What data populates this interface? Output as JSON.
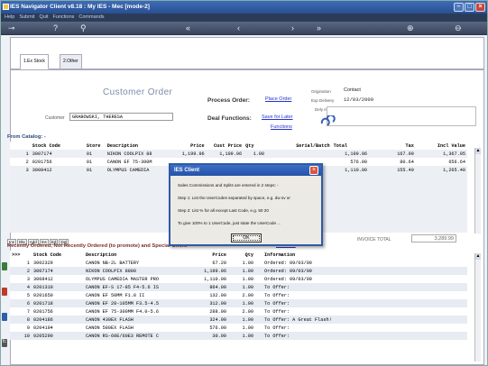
{
  "window": {
    "title": "IES Navigator Client v8.18 : My IES - Mec   [mode-2]"
  },
  "menu": [
    "Help",
    "Submit",
    "Quit",
    "Functions",
    "Commands"
  ],
  "tabs": [
    {
      "label": "1.Ex Stock"
    },
    {
      "label": "2.Other"
    }
  ],
  "order": {
    "title": "Customer Order",
    "process_label": "Process Order:",
    "place_order": "Place Order",
    "origination_label": "Origination",
    "origination_value": "Contact",
    "exp_delivery_label": "Exp Delivery",
    "exp_delivery_value": "12/03/2009",
    "dely_instr_label": "Dely Instr",
    "customer_label": "Customer",
    "customer_value": "GRABOWSKI, THERESA",
    "deal_label": "Deal Functions:",
    "save_later": "Save for Later",
    "functions": "Functions"
  },
  "catalog": {
    "title": "From Catalog: -",
    "headers": [
      "",
      "Stock Code",
      "Store",
      "Description",
      "Price",
      "Cust Price",
      "Qty",
      "Serial/Batch",
      "Total",
      "Tax",
      "Incl Value"
    ],
    "rows": [
      {
        "n": "1",
        "code": "3007174",
        "store": "01",
        "desc": "NIKON COOLPIX 88",
        "price": "1,199.96",
        "cust": "1,199.96",
        "qty": "1.00",
        "serial": "",
        "total": "1,199.96",
        "tax": "167.99",
        "incl": "1,367.95"
      },
      {
        "n": "2",
        "code": "0201756",
        "store": "01",
        "desc": "CANON EF 75-300M",
        "price": "",
        "cust": "",
        "qty": "",
        "serial": "",
        "total": "576.00",
        "tax": "80.64",
        "incl": "656.64"
      },
      {
        "n": "3",
        "code": "3008412",
        "store": "01",
        "desc": "OLYMPUS CAMEDIA",
        "price": "",
        "cust": "",
        "qty": "",
        "serial": "",
        "total": "1,110.00",
        "tax": "155.40",
        "incl": "1,265.40"
      }
    ],
    "edit_buttons": [
      "Ins",
      "Dle",
      "Add",
      "Ins",
      "Ed",
      "Del"
    ]
  },
  "invoice": {
    "label": "INVOICE TOTAL",
    "value": "3,289.99"
  },
  "recent": {
    "title": "Recently Ordered, Not Recently Ordered (to promote) and Special Offers",
    "reorder": "RE-ORD",
    "headers": [
      ">>>",
      "Stock Code",
      "Description",
      "Price",
      "Qty",
      "Information"
    ],
    "rows": [
      {
        "n": "1",
        "code": "3002329",
        "desc": "CANON NB-2L BATTERY",
        "price": "67.20",
        "qty": "1.00",
        "info": "Ordered: 09/03/09"
      },
      {
        "n": "2",
        "code": "3007174",
        "desc": "NIKON COOLPIX 8800",
        "price": "1,199.96",
        "qty": "1.00",
        "info": "Ordered: 09/03/09"
      },
      {
        "n": "3",
        "code": "3008412",
        "desc": "OLYMPUS CAMEDIA MASTER PRO",
        "price": "1,110.00",
        "qty": "1.00",
        "info": "Ordered: 09/03/09"
      },
      {
        "n": "4",
        "code": "0201310",
        "desc": "CANON EF-S 17-85 F4-5.6 IS",
        "price": "864.00",
        "qty": "1.00",
        "info": "To Offer:"
      },
      {
        "n": "5",
        "code": "0201650",
        "desc": "CANON EF 50MM F1.8 II",
        "price": "132.00",
        "qty": "2.00",
        "info": "To Offer:"
      },
      {
        "n": "6",
        "code": "0201718",
        "desc": "CANON EF 28-105MM F3.5-4.5",
        "price": "312.00",
        "qty": "1.00",
        "info": "To Offer:"
      },
      {
        "n": "7",
        "code": "0201756",
        "desc": "CANON EF 75-300MM F4.0-5.6",
        "price": "288.00",
        "qty": "2.00",
        "info": "To Offer:"
      },
      {
        "n": "8",
        "code": "0204186",
        "desc": "CANON 430EX FLASH",
        "price": "324.00",
        "qty": "1.00",
        "info": "To Offer: A Great Flash!"
      },
      {
        "n": "9",
        "code": "0204194",
        "desc": "CANON 580EX FLASH",
        "price": "576.00",
        "qty": "1.00",
        "info": "To Offer:"
      },
      {
        "n": "10",
        "code": "0205290",
        "desc": "CANON RS-60E/60E3 REMOTE C",
        "price": "30.00",
        "qty": "1.00",
        "info": "To Offer:"
      }
    ]
  },
  "dialog": {
    "title": "IES Client",
    "lines": [
      "Sales Commissions and Splits are entered in 2 steps: -",
      "Step 1: List the UserCodes separated by space, e.g. dw sv or",
      "Step 2: List % for all except Last Code, e.g. 50 20",
      "To give 100% to 1 UserCode, just state the UserCode ..."
    ],
    "ok": "OK"
  },
  "colors": {
    "titlebar": "#2a4f93",
    "link": "#2233cc",
    "section": "#7b2d2d"
  }
}
